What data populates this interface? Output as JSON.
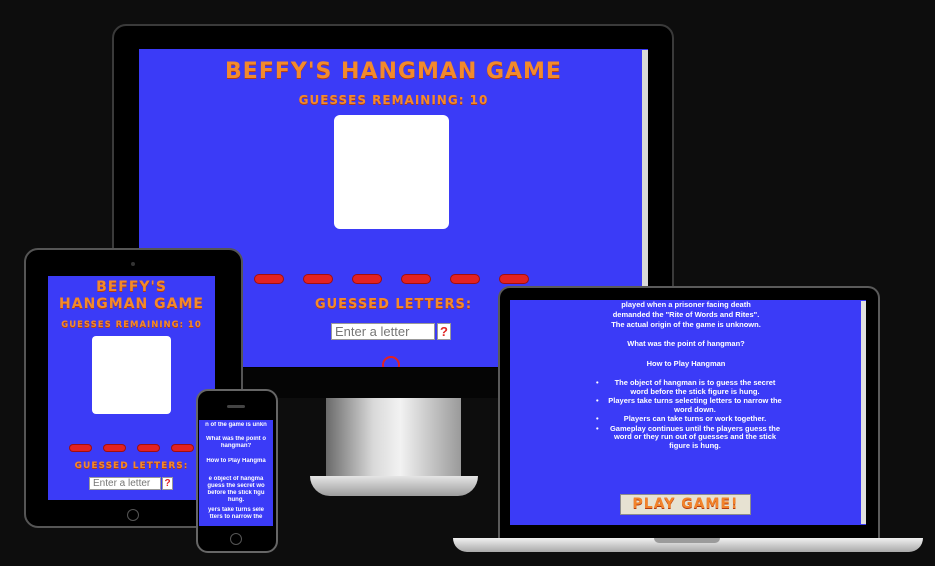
{
  "desktop": {
    "title": "BEFFY'S HANGMAN GAME",
    "guesses_remaining": "GUESSES REMAINING: 10",
    "guessed_letters_label": "GUESSED LETTERS:",
    "input_placeholder": "Enter a letter",
    "help_label": "?"
  },
  "tablet": {
    "title": "BEFFY'S HANGMAN GAME",
    "guesses_remaining": "GUESSES REMAINING: 10",
    "guessed_letters_label": "GUESSED LETTERS:",
    "input_placeholder": "Enter a letter",
    "help_label": "?"
  },
  "phone": {
    "lines": [
      "n of the game is unkn",
      "What was the point o",
      "hangman?",
      "How to Play Hangma",
      "e object of hangma",
      "guess the secret wo",
      "before the stick figu",
      "hung.",
      "yers take turns sele",
      "tters to narrow the"
    ]
  },
  "laptop": {
    "intro": [
      "played when a prisoner facing death",
      "demanded the \"Rite of Words and Rites\".",
      "The actual origin of the game is unknown."
    ],
    "question": "What was the point of hangman?",
    "how_to_heading": "How to Play Hangman",
    "rules": [
      "The object of hangman is to guess the secret word before the stick figure is hung.",
      "Players take turns selecting letters to narrow the word down.",
      "Players can take turns or work together.",
      "Gameplay continues until the players guess the word or they run out of guesses and the stick figure is hung."
    ],
    "play_button": "PLAY GAME!"
  }
}
